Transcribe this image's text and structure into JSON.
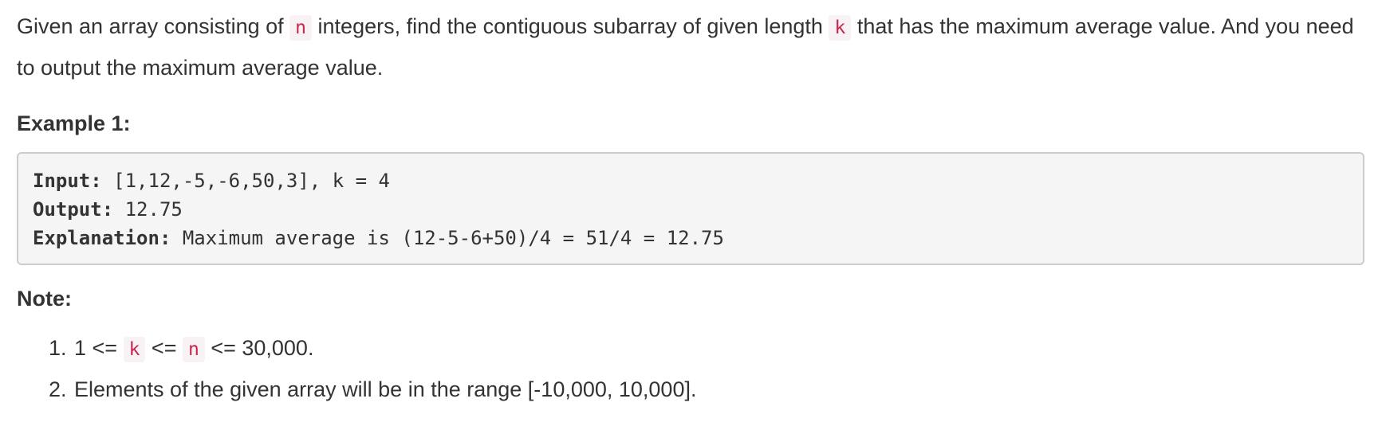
{
  "description": {
    "part1": "Given an array consisting of ",
    "code_n": "n",
    "part2": " integers, find the contiguous subarray of given length ",
    "code_k": "k",
    "part3": " that has the maximum average value. And you need to output the maximum average value."
  },
  "example": {
    "heading": "Example 1:",
    "input_label": "Input:",
    "input_value": " [1,12,-5,-6,50,3], k = 4",
    "output_label": "Output:",
    "output_value": " 12.75",
    "explanation_label": "Explanation:",
    "explanation_value": " Maximum average is (12-5-6+50)/4 = 51/4 = 12.75"
  },
  "note": {
    "heading": "Note:",
    "items": [
      {
        "prefix": "1 <= ",
        "code1": "k",
        "mid": " <= ",
        "code2": "n",
        "suffix": " <= 30,000."
      },
      {
        "text": "Elements of the given array will be in the range [-10,000, 10,000]."
      }
    ]
  }
}
